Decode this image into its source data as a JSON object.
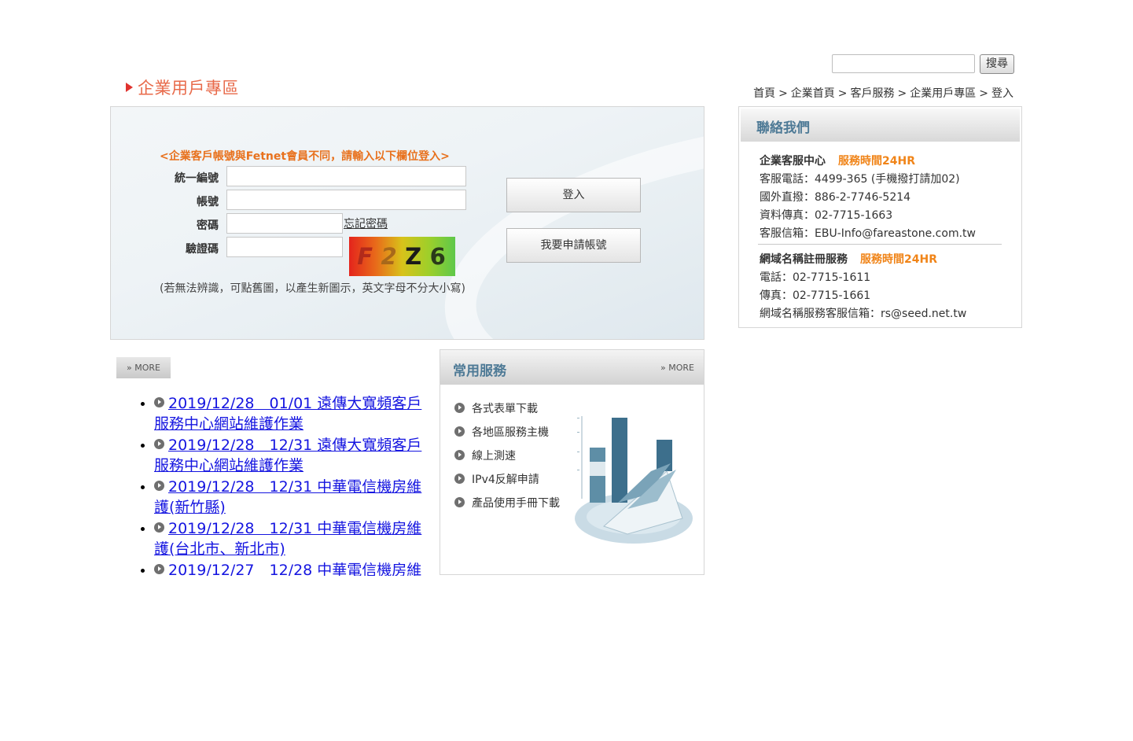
{
  "search": {
    "value": "",
    "button_label": "搜尋"
  },
  "page_title": "企業用戶專區",
  "breadcrumb": [
    "首頁",
    "企業首頁",
    "客戶服務",
    "企業用戶專區",
    "登入"
  ],
  "breadcrumb_separator": ">",
  "login": {
    "notice": "<企業客戶帳號與Fetnet會員不同，請輸入以下欄位登入>",
    "fields": [
      {
        "label": "統一編號",
        "value": ""
      },
      {
        "label": "帳號",
        "value": ""
      },
      {
        "label": "密碼",
        "value": ""
      },
      {
        "label": "驗證碼",
        "value": ""
      }
    ],
    "forgot_password": "忘記密碼",
    "captcha_text": [
      "F",
      "2",
      "Z",
      "6"
    ],
    "captcha_hint": "(若無法辨識，可點舊圖，以產生新圖示，英文字母不分大小寫)",
    "login_button": "登入",
    "apply_button": "我要申請帳號"
  },
  "contact": {
    "title": "聯絡我們",
    "enterprise_center": {
      "name": "企業客服中心",
      "hours": "服務時間24HR",
      "lines": [
        "客服電話：4499-365 (手機撥打請加02)",
        "國外直撥：886-2-7746-5214",
        "資料傳真：02-7715-1663",
        "客服信箱：EBU-Info@fareastone.com.tw"
      ]
    },
    "domain_service": {
      "name": "網域名稱註冊服務",
      "hours": "服務時間24HR",
      "lines": [
        "電話：02-7715-1611",
        "傳真：02-7715-1661",
        "網域名稱服務客服信箱：rs@seed.net.tw"
      ]
    }
  },
  "news": {
    "more_label": "» MORE",
    "items": [
      "2019/12/28　01/01 遠傳大寬頻客戶服務中心網站維護作業",
      "2019/12/28　12/31 遠傳大寬頻客戶服務中心網站維護作業",
      "2019/12/28　12/31 中華電信機房維護(新竹縣)",
      "2019/12/28　12/31 中華電信機房維護(台北市、新北市)",
      "2019/12/27　12/28 中華電信機房維"
    ]
  },
  "services": {
    "title": "常用服務",
    "more_label": "» MORE",
    "items": [
      "各式表單下載",
      "各地區服務主機",
      "線上測速",
      "IPv4反解申請",
      "產品使用手冊下載"
    ]
  },
  "colors": {
    "accent_orange": "#f08418",
    "title_red": "#e86a4a",
    "link_blue": "#1515e0",
    "header_blue": "#4e7a96"
  }
}
